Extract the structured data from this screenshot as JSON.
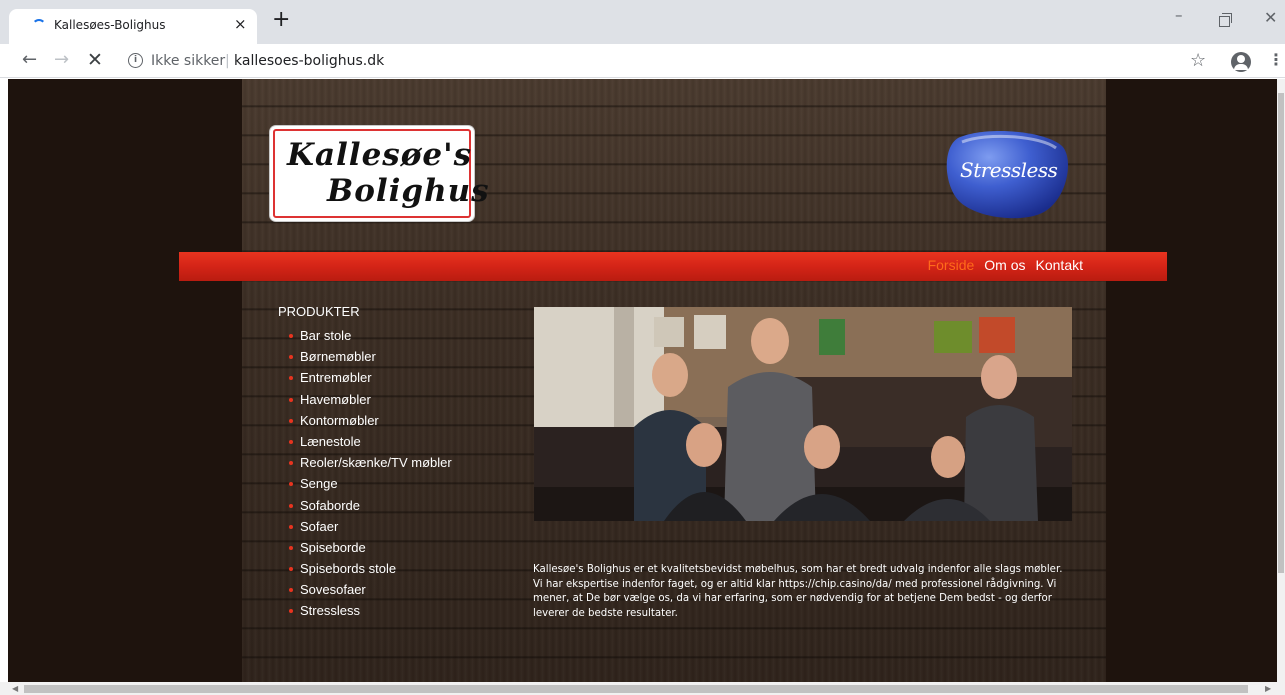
{
  "browser": {
    "tab_title": "Kallesøes-Bolighus",
    "tab_close": "×",
    "new_tab": "+",
    "security_label": "Ikke sikker",
    "url": "kallesoes-bolighus.dk",
    "loading": true
  },
  "site": {
    "logo_text": [
      "Kallesøe's",
      "Bolighus"
    ],
    "brand_logo_text": "Stressless",
    "nav": [
      {
        "label": "Forside",
        "active": true
      },
      {
        "label": "Om os",
        "active": false
      },
      {
        "label": "Kontakt",
        "active": false
      }
    ],
    "sidebar": {
      "heading": "PRODUKTER",
      "items": [
        "Bar stole",
        "Børnemøbler",
        "Entremøbler",
        "Havemøbler",
        "Kontormøbler",
        "Lænestole",
        "Reoler/skænke/TV møbler",
        "Senge",
        "Sofaborde",
        "Sofaer",
        "Spiseborde",
        "Spisebords stole",
        "Sovesofaer",
        "Stressless"
      ]
    },
    "about_text": "Kallesøe's Bolighus er et kvalitetsbevidst møbelhus, som har et bredt udvalg indenfor alle slags møbler. Vi har ekspertise indenfor faget, og er altid klar https://chip.casino/da/ med professionel rådgivning. Vi mener, at De bør vælge os, da vi har erfaring, som er nødvendig for at betjene Dem bedst - og derfor leverer de bedste resultater."
  },
  "colors": {
    "nav_bar": "#d42417",
    "nav_active": "#ff6a1a",
    "bullet": "#e8341f",
    "page_bg": "#1e130d",
    "brand_blue": "#2a3fa8"
  }
}
